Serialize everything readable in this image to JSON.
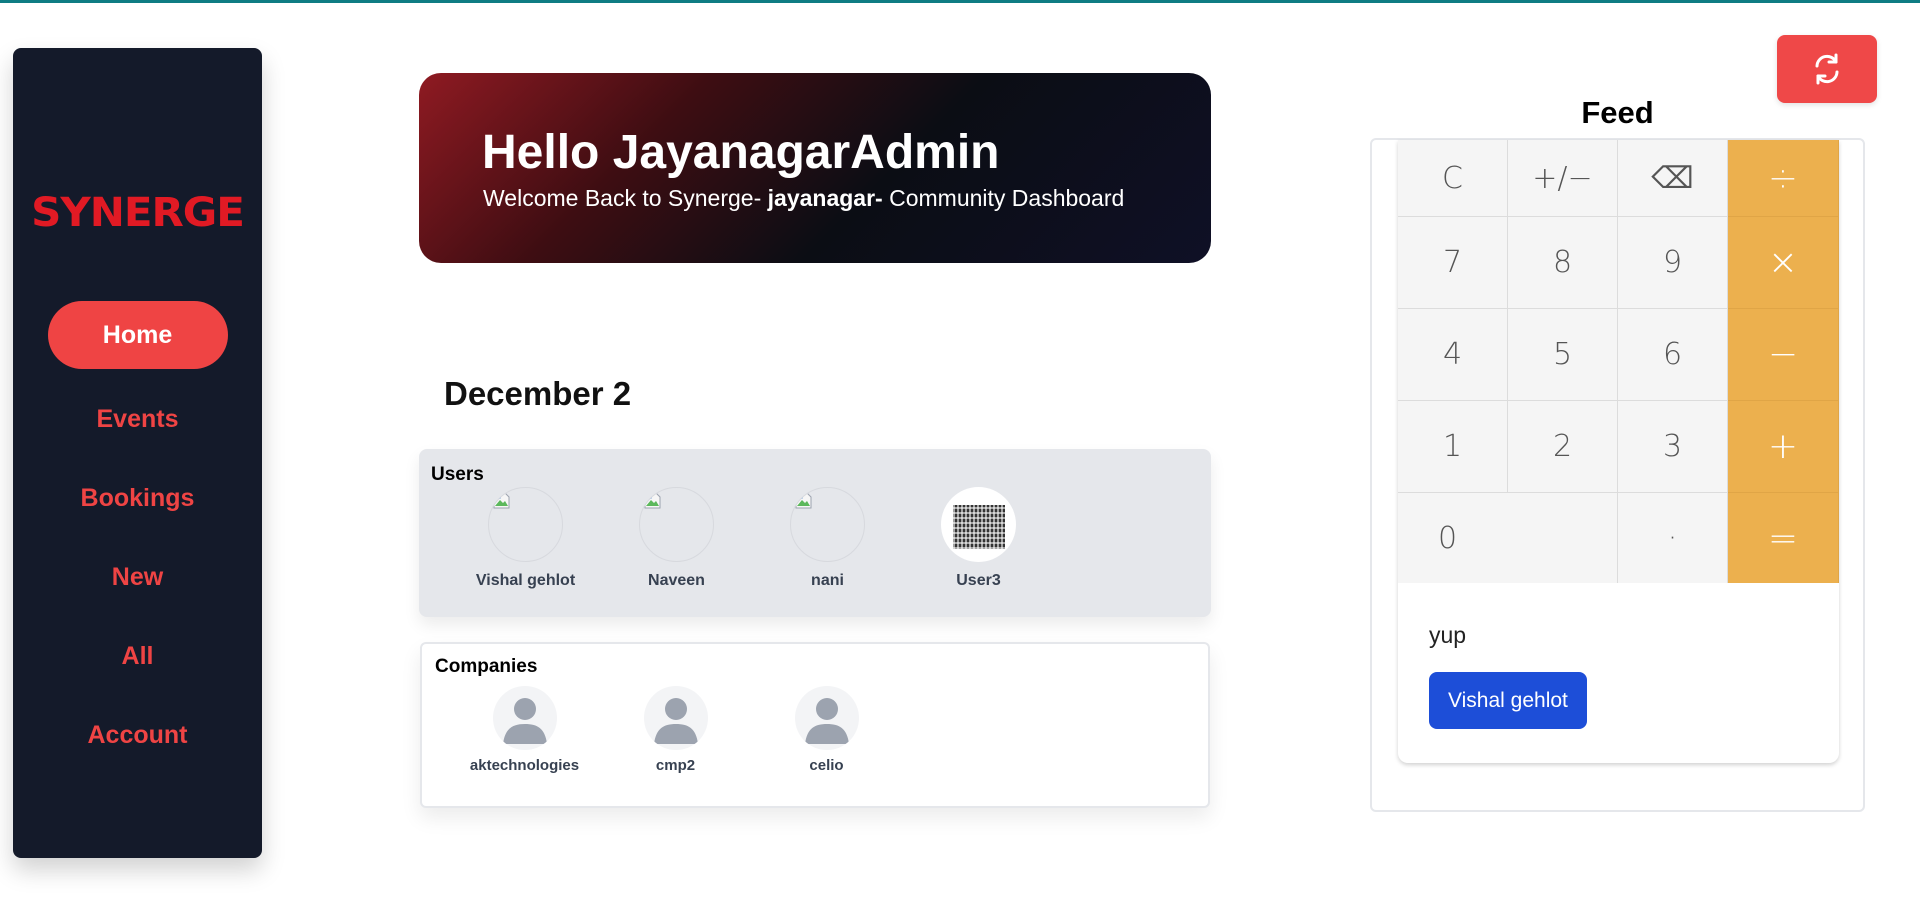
{
  "sidebar": {
    "logo_text": "SYNERGE",
    "items": [
      {
        "label": "Home",
        "active": true
      },
      {
        "label": "Events"
      },
      {
        "label": "Bookings"
      },
      {
        "label": "New"
      },
      {
        "label": "All"
      },
      {
        "label": "Account"
      }
    ]
  },
  "hero": {
    "title": "Hello JayanagarAdmin",
    "subtitle_prefix": "Welcome Back to Synerge- ",
    "subtitle_community": "jayanagar-",
    "subtitle_suffix": " Community Dashboard"
  },
  "date_heading": "December 2",
  "users": {
    "title": "Users",
    "items": [
      {
        "name": "Vishal gehlot",
        "avatar": "broken-image-icon"
      },
      {
        "name": "Naveen",
        "avatar": "broken-image-icon"
      },
      {
        "name": "nani",
        "avatar": "broken-image-icon"
      },
      {
        "name": "User3",
        "avatar": "qr-code-image"
      }
    ]
  },
  "companies": {
    "title": "Companies",
    "items": [
      {
        "name": "aktechnologies",
        "avatar": "user-placeholder-icon"
      },
      {
        "name": "cmp2",
        "avatar": "user-placeholder-icon"
      },
      {
        "name": "celio",
        "avatar": "user-placeholder-icon"
      }
    ]
  },
  "refresh": {
    "icon": "refresh-icon",
    "color": "#ef4848"
  },
  "feed": {
    "title": "Feed",
    "calculator": {
      "keys": [
        "C",
        "+/−",
        "⌫",
        "÷",
        "7",
        "8",
        "9",
        "×",
        "4",
        "5",
        "6",
        "−",
        "1",
        "2",
        "3",
        "+",
        "0",
        "·",
        "="
      ],
      "operator_color": "#ecb04e"
    },
    "post_text": "yup",
    "post_author": "Vishal gehlot"
  },
  "colors": {
    "accent": "#ef4444",
    "sidebar_bg": "#141a2a",
    "author_button": "#1d4ed8"
  }
}
